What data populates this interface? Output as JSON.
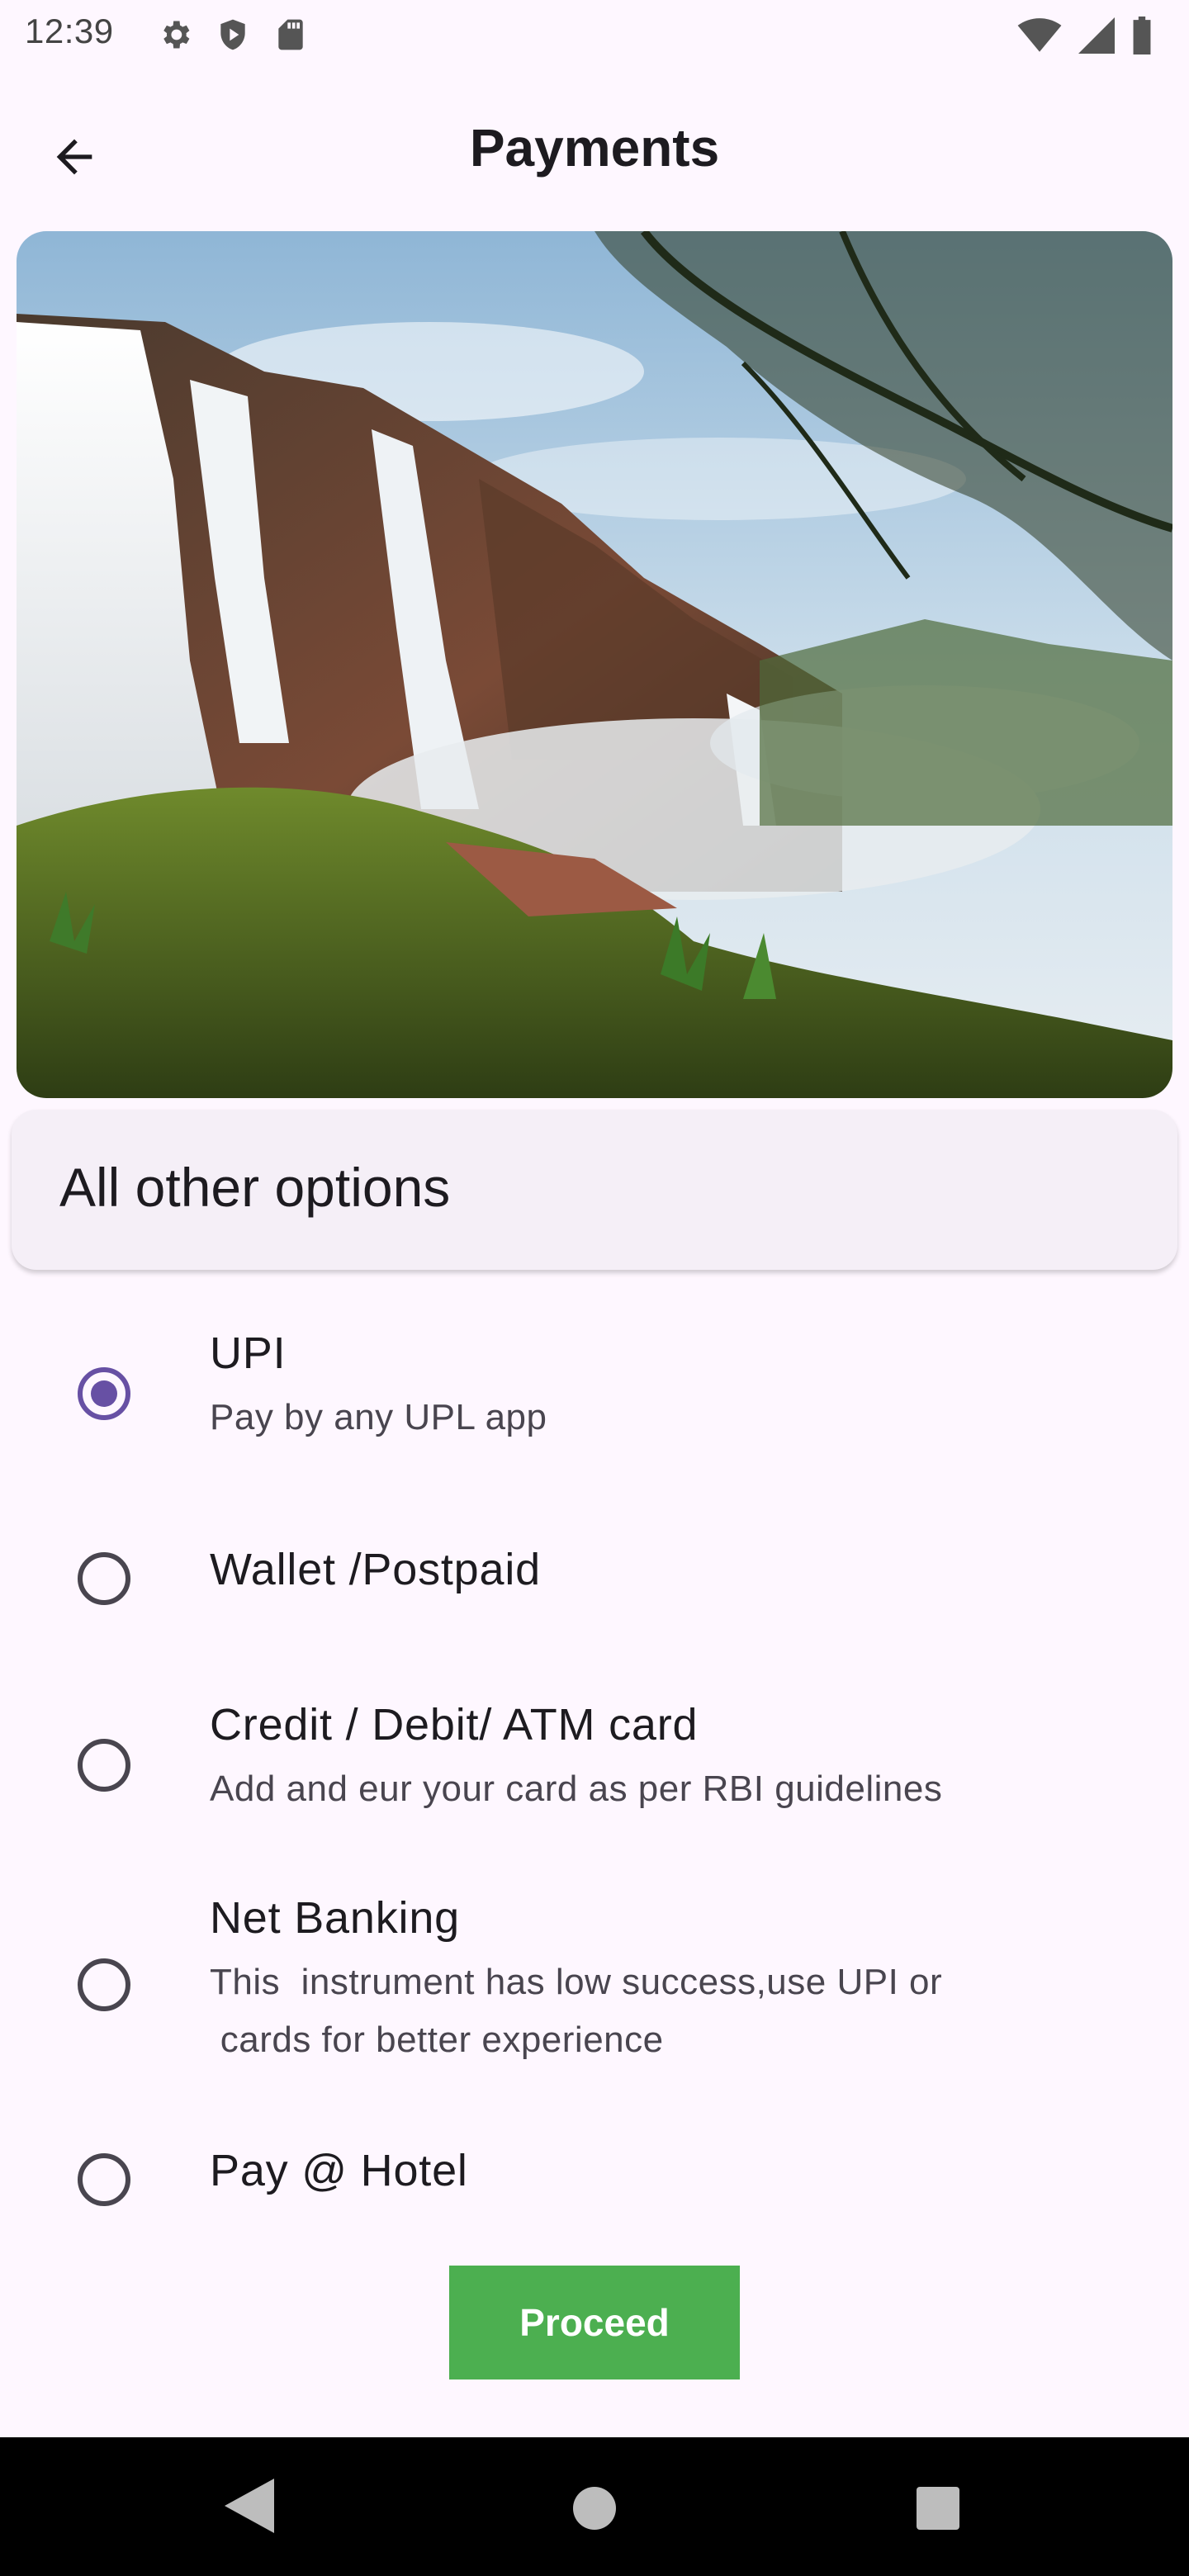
{
  "status_bar": {
    "time": "12:39",
    "left_icons": [
      "gear-icon",
      "shield-icon",
      "sd-card-icon"
    ],
    "right_icons": [
      "wifi-icon",
      "signal-icon",
      "battery-icon"
    ]
  },
  "app_bar": {
    "title": "Payments",
    "back_icon": "arrow-back-icon"
  },
  "hero_image": {
    "description_icon": "waterfall-landscape-image"
  },
  "options_header": "All other options",
  "payment_options": [
    {
      "title": "UPI",
      "subtitle": "Pay by any UPL app",
      "selected": true
    },
    {
      "title": "Wallet /Postpaid",
      "subtitle": "",
      "selected": false
    },
    {
      "title": "Credit / Debit/ ATM card",
      "subtitle": "Add and eur your card as per RBI guidelines",
      "selected": false
    },
    {
      "title": "Net Banking",
      "subtitle_line1": "This  instrument has low success,use UPI or",
      "subtitle_line2": " cards for better experience",
      "selected": false
    },
    {
      "title": "Pay @ Hotel",
      "subtitle": "",
      "selected": false
    }
  ],
  "proceed_label": "Proceed",
  "colors": {
    "background": "#FEF7FF",
    "accent": "#6750A4",
    "proceed": "#4CAF50",
    "header_card": "#F5EFF7"
  },
  "nav_bar": {
    "icons": [
      "nav-back-icon",
      "nav-home-icon",
      "nav-recents-icon"
    ]
  }
}
